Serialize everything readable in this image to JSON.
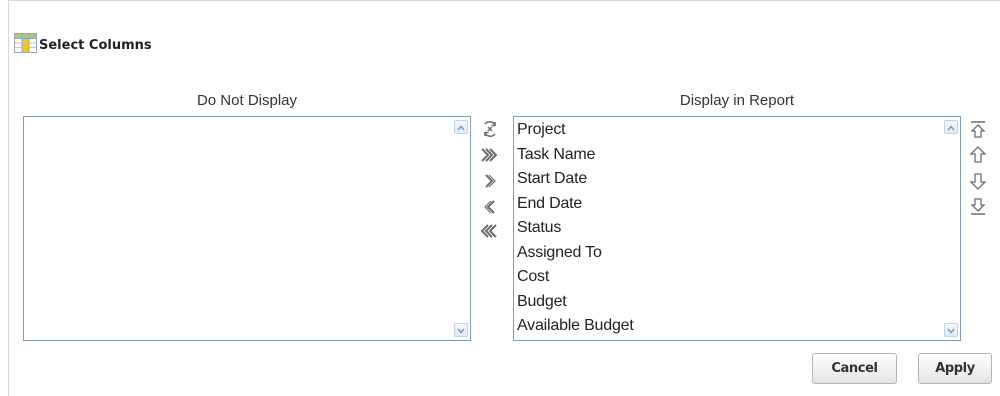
{
  "dialog": {
    "title": "Select Columns",
    "title_icon": "table-columns-icon"
  },
  "left": {
    "label": "Do Not Display",
    "items": []
  },
  "right": {
    "label": "Display in Report",
    "items": [
      "Project",
      "Task Name",
      "Start Date",
      "End Date",
      "Status",
      "Assigned To",
      "Cost",
      "Budget",
      "Available Budget"
    ]
  },
  "shuttle_icons": [
    "reset-icon",
    "move-all-icon",
    "move-icon",
    "remove-icon",
    "remove-all-icon"
  ],
  "order_icons": [
    "move-top-icon",
    "move-up-icon",
    "move-down-icon",
    "move-bottom-icon"
  ],
  "buttons": {
    "cancel": "Cancel",
    "apply": "Apply"
  },
  "colors": {
    "list_border": "#7f9db9",
    "icon_stroke": "#6d6d6d",
    "header_icon_yellow": "#f5c518",
    "header_icon_green": "#a8c97f"
  }
}
